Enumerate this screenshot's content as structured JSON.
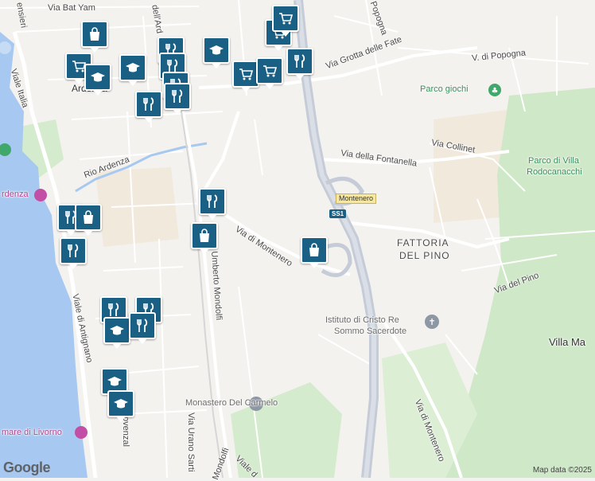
{
  "map": {
    "places": {
      "via_bat_yam": "Via Bat Yam",
      "viale_italia": "Viale Italia",
      "via_grotta_delle_fate": "Via Grotta delle Fate",
      "v_di_popogna": "V. di Popogna",
      "popogna_partial": "Popogna",
      "parco_giochi": "Parco giochi",
      "ardenza": "Ardenza",
      "rio_ardenza": "Rio Ardenza",
      "via_collinet": "Via Collinet",
      "via_della_fontanella": "Via della Fontanella",
      "parco_di_villa": "Parco di Villa",
      "rodocanacchi": "Rodocanacchi",
      "montenero": "Montenero",
      "ss1": "SS1",
      "via_di_montenero": "Via di Montenero",
      "fattoria_line1": "FATTORIA",
      "fattoria_line2": "DEL PINO",
      "via_del_pino": "Via del Pino",
      "umberto_mondolfi": "Umberto Mondolfi",
      "istituto_line1": "Istituto di Cristo Re",
      "istituto_line2": "Sommo Sacerdote",
      "villa_ma": "Villa Ma",
      "viale_di_antignano": "Viale di Antignano",
      "monastero": "Monastero Del Carmelo",
      "via_di_montenero_south": "Via di Montenero",
      "via_urano_sarti": "Via Urano Sarti",
      "provenzal": "Provenzal",
      "mondolfi_south": "Mondolfi",
      "viale_partial": "Viale d",
      "ardenza_left": "rdenza",
      "livorno": "mare di Livorno",
      "insieri": "ensieri",
      "dell_ard": "dell'Ard"
    },
    "markers": [
      {
        "kind": "shopping-bag"
      },
      {
        "kind": "grocery-cart"
      },
      {
        "kind": "restaurant"
      },
      {
        "kind": "school"
      },
      {
        "kind": "grocery-cart"
      },
      {
        "kind": "grocery-cart"
      },
      {
        "kind": "school"
      },
      {
        "kind": "grocery-cart"
      },
      {
        "kind": "grocery-cart"
      },
      {
        "kind": "restaurant"
      },
      {
        "kind": "restaurant"
      },
      {
        "kind": "restaurant"
      },
      {
        "kind": "school"
      },
      {
        "kind": "restaurant"
      },
      {
        "kind": "restaurant"
      },
      {
        "kind": "restaurant"
      },
      {
        "kind": "shopping-bag"
      },
      {
        "kind": "restaurant"
      },
      {
        "kind": "shopping-bag"
      },
      {
        "kind": "restaurant"
      },
      {
        "kind": "restaurant"
      },
      {
        "kind": "restaurant"
      },
      {
        "kind": "school"
      },
      {
        "kind": "restaurant"
      },
      {
        "kind": "shopping-bag"
      },
      {
        "kind": "school"
      },
      {
        "kind": "school"
      }
    ],
    "google_logo": "Google",
    "attribution": "Map data ©2025",
    "colors": {
      "sea": "#a7c8f0",
      "park": "#cfe8c8",
      "marker": "#1a5f84",
      "highway": "#c5ccd8"
    }
  }
}
